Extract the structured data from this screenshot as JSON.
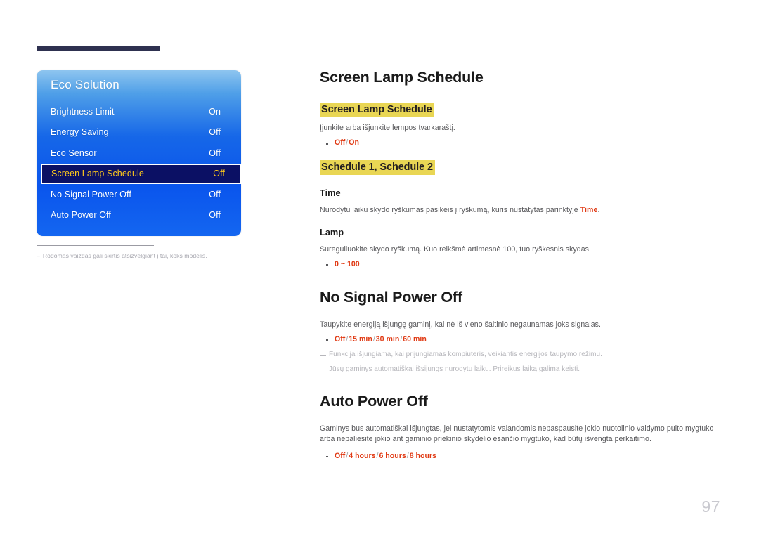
{
  "page": {
    "number": "97"
  },
  "osd": {
    "title": "Eco Solution",
    "rows": [
      {
        "label": "Brightness Limit",
        "value": "On",
        "selected": false
      },
      {
        "label": "Energy Saving",
        "value": "Off",
        "selected": false
      },
      {
        "label": "Eco Sensor",
        "value": "Off",
        "selected": false
      },
      {
        "label": "Screen Lamp Schedule",
        "value": "Off",
        "selected": true
      },
      {
        "label": "No Signal Power Off",
        "value": "Off",
        "selected": false
      },
      {
        "label": "Auto Power Off",
        "value": "Off",
        "selected": false
      }
    ]
  },
  "left_note": {
    "dash": "–",
    "text": "Rodomas vaizdas gali skirtis atsižvelgiant į tai, koks modelis."
  },
  "sections": {
    "screen_lamp_schedule": {
      "title": "Screen Lamp Schedule",
      "highlight_1": "Screen Lamp Schedule",
      "desc_1": "Įjunkite arba išjunkite lempos tvarkaraštį.",
      "options_1": [
        "Off",
        "On"
      ],
      "highlight_2": "Schedule 1, Schedule 2",
      "time": {
        "heading": "Time",
        "desc_prefix": "Nurodytu laiku skydo ryškumas pasikeis į ryškumą, kuris nustatytas parinktyje ",
        "desc_highlight": "Time",
        "desc_suffix": "."
      },
      "lamp": {
        "heading": "Lamp",
        "desc": "Sureguliuokite skydo ryškumą. Kuo reikšmė artimesnė 100, tuo ryškesnis skydas.",
        "options": [
          "0 ~ 100"
        ]
      }
    },
    "no_signal_power_off": {
      "title": "No Signal Power Off",
      "desc": "Taupykite energiją išjungę gaminį, kai nė iš vieno šaltinio negaunamas joks signalas.",
      "options": [
        "Off",
        "15 min",
        "30 min",
        "60 min"
      ],
      "notes": [
        "Funkcija išjungiama, kai prijungiamas kompiuteris, veikiantis energijos taupymo režimu.",
        "Jūsų gaminys automatiškai išsijungs nurodytu laiku. Prireikus laiką galima keisti."
      ]
    },
    "auto_power_off": {
      "title": "Auto Power Off",
      "desc": "Gaminys bus automatiškai išjungtas, jei nustatytomis valandomis nepaspausite jokio nuotolinio valdymo pulto mygtuko arba nepaliesite jokio ant gaminio priekinio skydelio esančio mygtuko, kad būtų išvengta perkaitimo.",
      "options": [
        "Off",
        "4 hours",
        "6 hours",
        "8 hours"
      ]
    }
  },
  "colors": {
    "highlight_yellow": "#e9d654",
    "option_red": "#e03a14",
    "osd_blue": "#1667e8",
    "osd_selected_bg": "#0b1064",
    "osd_selected_text": "#ffc91b",
    "header_bar": "#2e3150"
  }
}
